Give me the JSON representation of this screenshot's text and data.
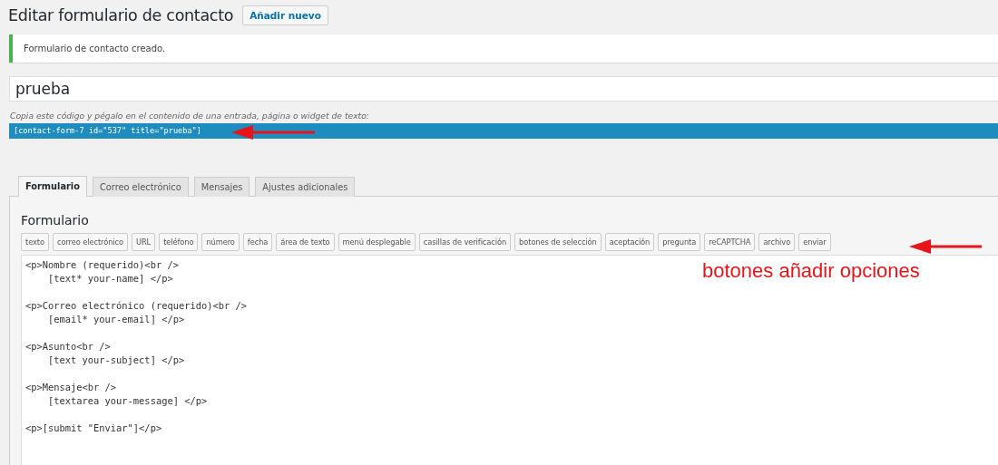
{
  "page": {
    "title": "Editar formulario de contacto",
    "add_new_button": "Añadir nuevo"
  },
  "notice": {
    "message": "Formulario de contacto creado."
  },
  "form_title": {
    "value": "prueba"
  },
  "shortcode": {
    "hint": "Copia este código y pégalo en el contenido de una entrada, página o widget de texto:",
    "code": "[contact-form-7 id=\"537\" title=\"prueba\"]"
  },
  "tabs": [
    {
      "label": "Formulario",
      "selected": true
    },
    {
      "label": "Correo electrónico",
      "selected": false
    },
    {
      "label": "Mensajes",
      "selected": false
    },
    {
      "label": "Ajustes adicionales",
      "selected": false
    }
  ],
  "panel": {
    "heading": "Formulario",
    "tag_buttons": [
      "texto",
      "correo electrónico",
      "URL",
      "teléfono",
      "número",
      "fecha",
      "área de texto",
      "menú desplegable",
      "casillas de verificación",
      "botones de selección",
      "aceptación",
      "pregunta",
      "reCAPTCHA",
      "archivo",
      "enviar"
    ],
    "editor": {
      "blocks": [
        [
          "<p>Nombre (requerido)<br />",
          "    [text* your-name] </p>"
        ],
        [
          "<p>Correo electrónico (requerido)<br />",
          "    [email* your-email] </p>"
        ],
        [
          "<p>Asunto<br />",
          "    [text your-subject] </p>"
        ],
        [
          "<p>Mensaje<br />",
          "    [textarea your-message] </p>"
        ],
        [
          "<p>[submit \"Enviar\"]</p>"
        ]
      ]
    }
  },
  "annotations": {
    "shortcode_arrow": true,
    "buttons_arrow": true,
    "note": "botones añadir opciones"
  }
}
